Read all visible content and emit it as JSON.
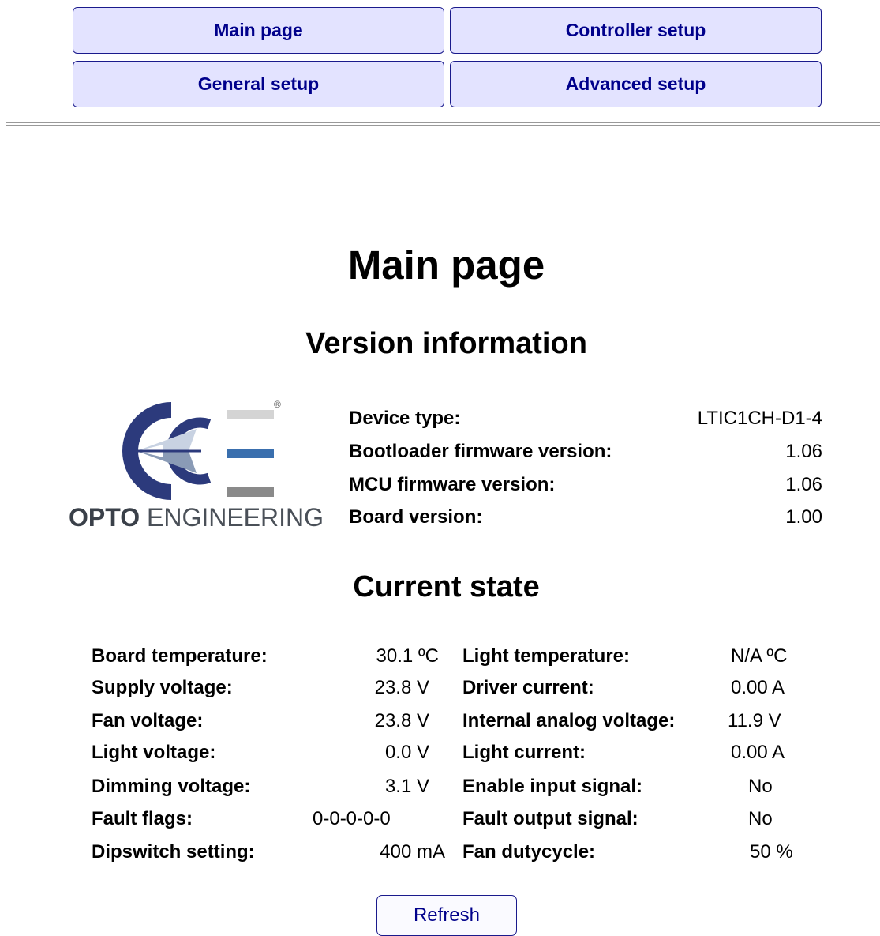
{
  "nav": {
    "main_page": "Main page",
    "controller_setup": "Controller setup",
    "general_setup": "General setup",
    "advanced_setup": "Advanced setup"
  },
  "page_title": "Main page",
  "version_section": {
    "heading": "Version information",
    "logo": {
      "brand_bold": "OPTO",
      "brand_rest": " ENGINEERING",
      "registered_mark": "®"
    },
    "rows": [
      {
        "label": "Device type:",
        "value": "LTIC1CH-D1-4"
      },
      {
        "label": "Bootloader firmware version:",
        "value": "1.06"
      },
      {
        "label": "MCU firmware version:",
        "value": "1.06"
      },
      {
        "label": "Board version:",
        "value": "1.00"
      }
    ]
  },
  "state_section": {
    "heading": "Current state",
    "left": [
      {
        "label": "Board temperature:",
        "value": "30.1 ºC"
      },
      {
        "label": "Supply voltage:",
        "value": "23.8 V"
      },
      {
        "label": "Fan voltage:",
        "value": "23.8 V"
      },
      {
        "label": "Light voltage:",
        "value": "0.0 V"
      },
      {
        "label": "Dimming voltage:",
        "value": "3.1 V"
      },
      {
        "label": "Fault flags:",
        "value": "0-0-0-0-0"
      },
      {
        "label": "Dipswitch setting:",
        "value": "400 mA"
      }
    ],
    "right": [
      {
        "label": "Light temperature:",
        "value": "N/A ºC"
      },
      {
        "label": "Driver current:",
        "value": "0.00 A"
      },
      {
        "label": "Internal analog voltage:",
        "value": "11.9 V"
      },
      {
        "label": "Light current:",
        "value": "0.00 A"
      },
      {
        "label": "Enable input signal:",
        "value": "No"
      },
      {
        "label": "Fault output signal:",
        "value": "No"
      },
      {
        "label": "Fan dutycycle:",
        "value": "50 %"
      }
    ]
  },
  "refresh_label": "Refresh"
}
